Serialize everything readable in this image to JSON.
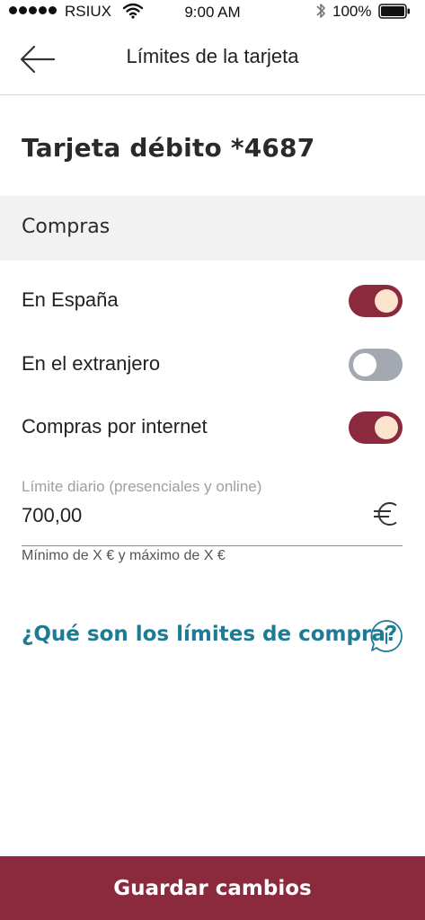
{
  "status_bar": {
    "carrier": "RSIUX",
    "time": "9:00 AM",
    "battery": "100%"
  },
  "header": {
    "title": "Límites de la tarjeta",
    "back_icon": "arrow-left-icon"
  },
  "card": {
    "title": "Tarjeta débito *4687"
  },
  "section": {
    "title": "Compras"
  },
  "toggles": [
    {
      "label": "En España",
      "on": true
    },
    {
      "label": "En el extranjero",
      "on": false
    },
    {
      "label": "Compras por internet",
      "on": true
    }
  ],
  "daily_limit": {
    "label": "Límite diario (presenciales y online)",
    "value": "700,00",
    "currency_icon": "euro-icon",
    "helper": "Mínimo de X € y máximo de X €"
  },
  "info": {
    "link_text": "¿Qué son los límites de compra?",
    "icon": "info-icon"
  },
  "footer": {
    "save_label": "Guardar cambios"
  },
  "colors": {
    "brand": "#8a2a3c",
    "link": "#1e7b96",
    "toggle_off": "#a4a9b1",
    "knob_on": "#fbe3cc"
  }
}
